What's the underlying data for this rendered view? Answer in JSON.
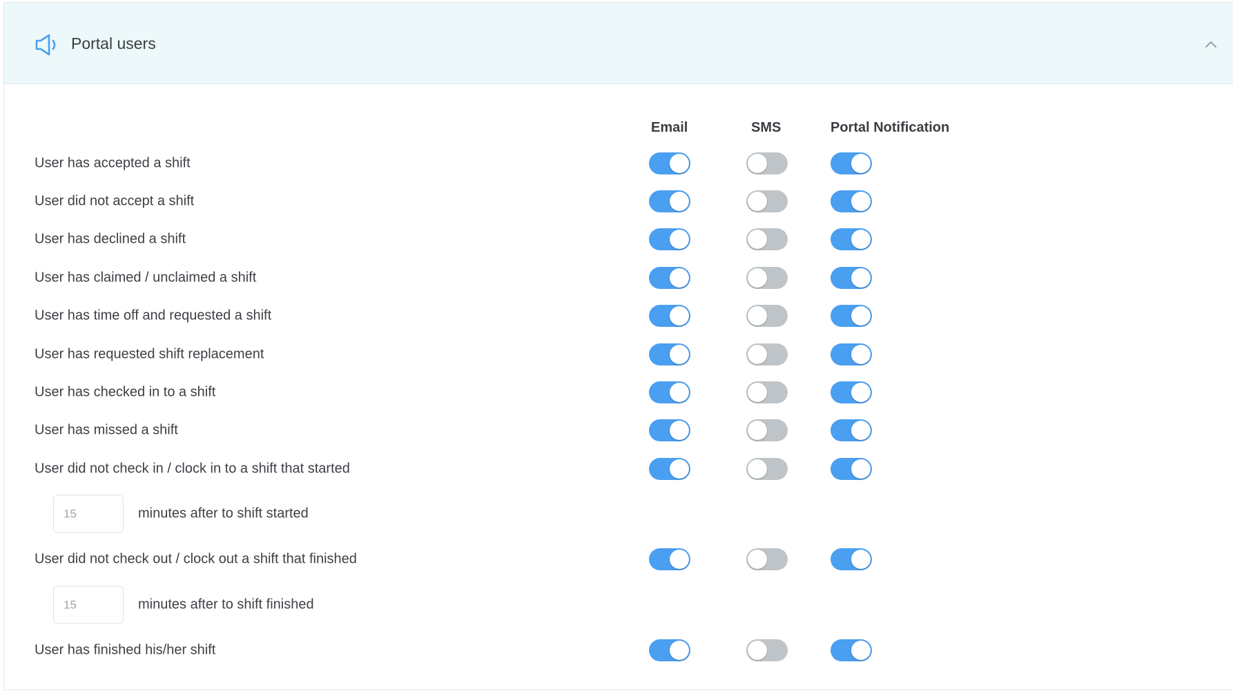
{
  "header": {
    "title": "Portal users",
    "icon": "speaker-icon",
    "accent": "#4a9ff0",
    "background": "#ecf8f9"
  },
  "columns": [
    "Email",
    "SMS",
    "Portal Notification"
  ],
  "rows": [
    {
      "label": "User has accepted a shift",
      "email": true,
      "sms": false,
      "portal": true
    },
    {
      "label": "User did not accept a shift",
      "email": true,
      "sms": false,
      "portal": true
    },
    {
      "label": "User has declined a shift",
      "email": true,
      "sms": false,
      "portal": true
    },
    {
      "label": "User has claimed / unclaimed a shift",
      "email": true,
      "sms": false,
      "portal": true
    },
    {
      "label": "User has time off and requested a shift",
      "email": true,
      "sms": false,
      "portal": true
    },
    {
      "label": "User has requested shift replacement",
      "email": true,
      "sms": false,
      "portal": true
    },
    {
      "label": "User has checked in to a shift",
      "email": true,
      "sms": false,
      "portal": true
    },
    {
      "label": "User has missed a shift",
      "email": true,
      "sms": false,
      "portal": true
    },
    {
      "label": "User did not check in / clock in to a shift that started",
      "email": true,
      "sms": false,
      "portal": true
    },
    {
      "label": "User did not check out / clock out a shift that finished",
      "email": true,
      "sms": false,
      "portal": true
    },
    {
      "label": "User has finished his/her shift",
      "email": true,
      "sms": false,
      "portal": true
    }
  ],
  "minutes_settings": [
    {
      "value": "15",
      "label": "minutes after to shift started"
    },
    {
      "value": "15",
      "label": "minutes after to shift finished"
    }
  ],
  "colors": {
    "toggle_on": "#4a9ff0",
    "toggle_off": "#bfc4c8"
  }
}
